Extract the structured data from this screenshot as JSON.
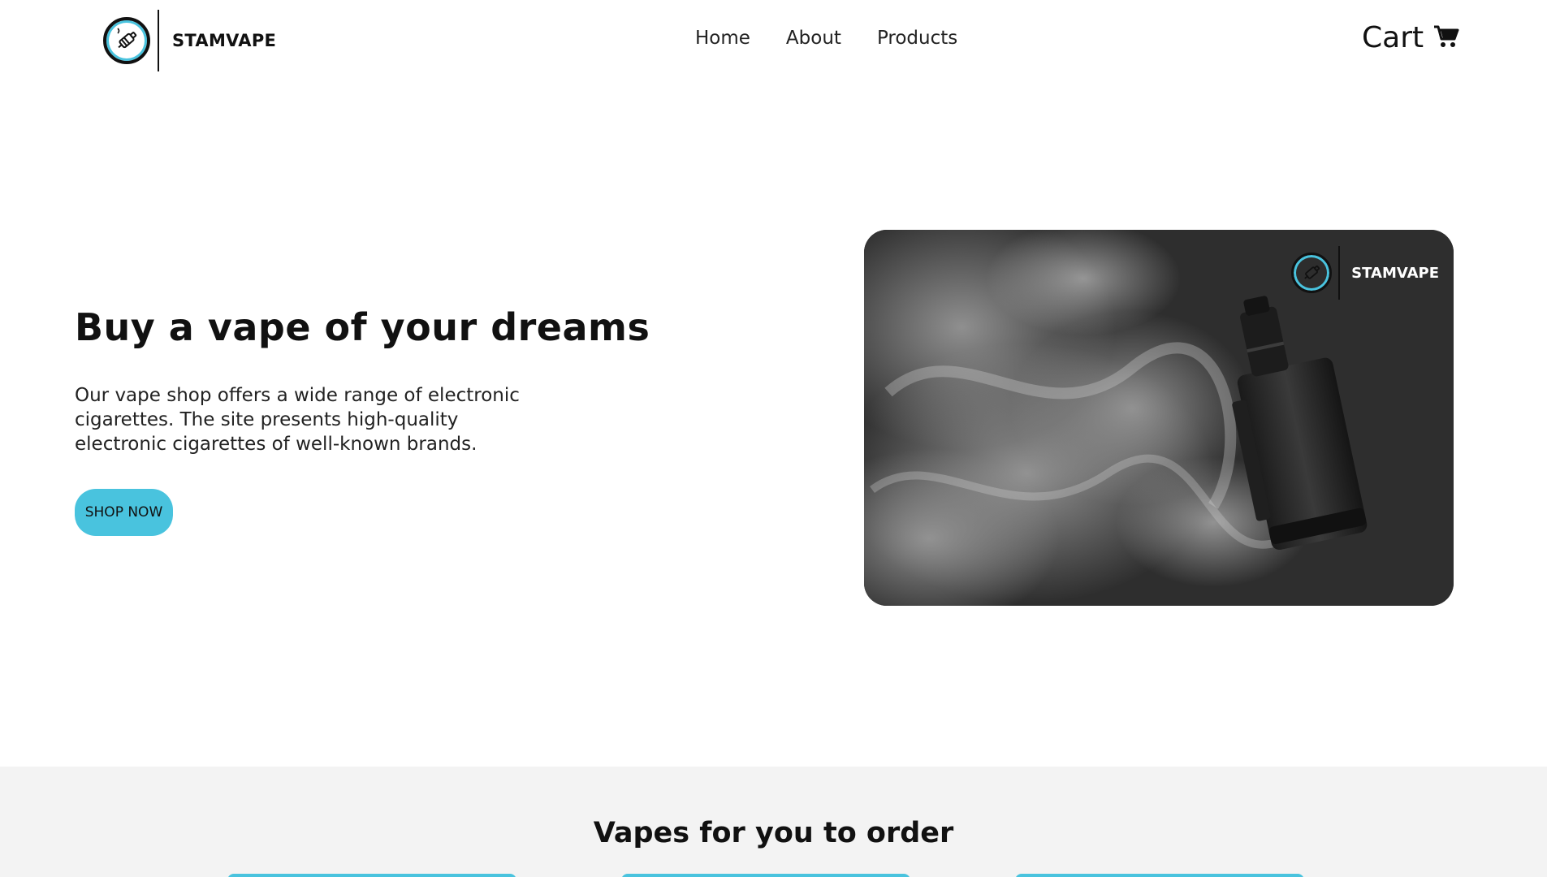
{
  "brand": {
    "name": "STAMVAPE"
  },
  "nav": {
    "items": [
      {
        "label": "Home"
      },
      {
        "label": "About"
      },
      {
        "label": "Products"
      }
    ]
  },
  "cart": {
    "label": "Cart",
    "icon": "cart-icon"
  },
  "hero": {
    "title": "Buy a vape of your dreams",
    "description": "Our vape shop offers a wide range of electronic cigarettes. The site presents high-quality electronic cigarettes of well-known brands.",
    "button_label": "SHOP NOW",
    "image_brand": "STAMVAPE"
  },
  "products": {
    "title": "Vapes for you to order"
  },
  "colors": {
    "accent": "#49c3de",
    "section_bg": "#f3f3f3",
    "image_bg": "#2d2d2d"
  }
}
